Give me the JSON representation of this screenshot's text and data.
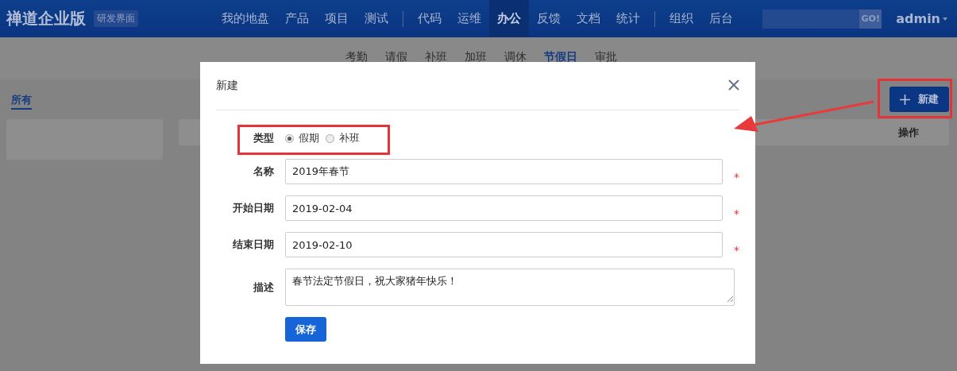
{
  "header": {
    "brand": "禅道企业版",
    "badge": "研发界面",
    "nav_groups": [
      [
        {
          "label": "我的地盘",
          "selected": false
        },
        {
          "label": "产品",
          "selected": false
        },
        {
          "label": "项目",
          "selected": false
        },
        {
          "label": "测试",
          "selected": false
        }
      ],
      [
        {
          "label": "代码",
          "selected": false
        },
        {
          "label": "运维",
          "selected": false
        },
        {
          "label": "办公",
          "selected": true
        },
        {
          "label": "反馈",
          "selected": false
        },
        {
          "label": "文档",
          "selected": false
        },
        {
          "label": "统计",
          "selected": false
        }
      ],
      [
        {
          "label": "组织",
          "selected": false
        },
        {
          "label": "后台",
          "selected": false
        }
      ]
    ],
    "search_button": "GO!",
    "user": "admin"
  },
  "subnav": [
    {
      "label": "考勤",
      "selected": false
    },
    {
      "label": "请假",
      "selected": false
    },
    {
      "label": "补班",
      "selected": false
    },
    {
      "label": "加班",
      "selected": false
    },
    {
      "label": "调休",
      "selected": false
    },
    {
      "label": "节假日",
      "selected": true
    },
    {
      "label": "审批",
      "selected": false
    }
  ],
  "tabs": [
    {
      "label": "所有",
      "selected": true
    }
  ],
  "new_button": "新建",
  "table": {
    "columns": [
      "操作"
    ]
  },
  "dialog": {
    "title": "新建",
    "type_field": {
      "label": "类型",
      "options": [
        {
          "label": "假期",
          "selected": true
        },
        {
          "label": "补班",
          "selected": false
        }
      ]
    },
    "fields": [
      {
        "label": "名称",
        "value": "2019年春节",
        "required_mark": "*"
      },
      {
        "label": "开始日期",
        "value": "2019-02-04",
        "required_mark": "*"
      },
      {
        "label": "结束日期",
        "value": "2019-02-10",
        "required_mark": "*"
      }
    ],
    "description": {
      "label": "描述",
      "value": "春节法定节假日，祝大家猪年快乐！"
    },
    "save_button": "保存"
  }
}
